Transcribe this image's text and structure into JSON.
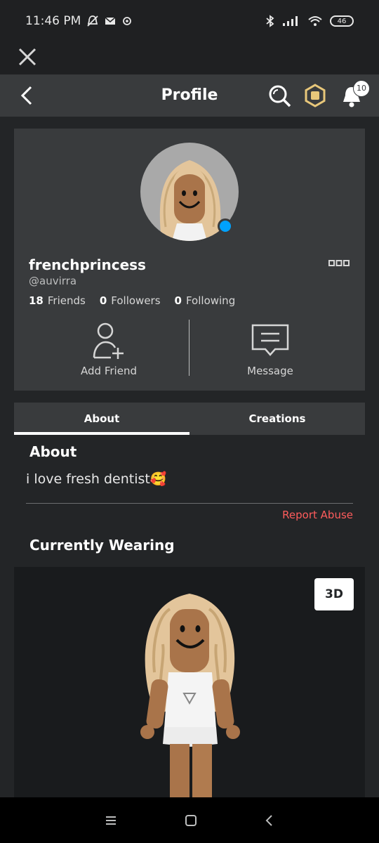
{
  "status_bar": {
    "time": "11:46 PM",
    "battery": "46"
  },
  "header": {
    "title": "Profile",
    "notification_count": "10"
  },
  "profile": {
    "display_name": "frenchprincess",
    "username": "@auvirra",
    "friends_count": "18",
    "friends_label": "Friends",
    "followers_count": "0",
    "followers_label": "Followers",
    "following_count": "0",
    "following_label": "Following",
    "add_friend_label": "Add Friend",
    "message_label": "Message",
    "online_color": "#00a2ff"
  },
  "tabs": [
    {
      "label": "About",
      "active": true
    },
    {
      "label": "Creations",
      "active": false
    }
  ],
  "about": {
    "title": "About",
    "bio": "i love fresh dentist🥰",
    "report_label": "Report Abuse"
  },
  "wearing": {
    "title": "Currently Wearing",
    "view_3d_label": "3D"
  }
}
